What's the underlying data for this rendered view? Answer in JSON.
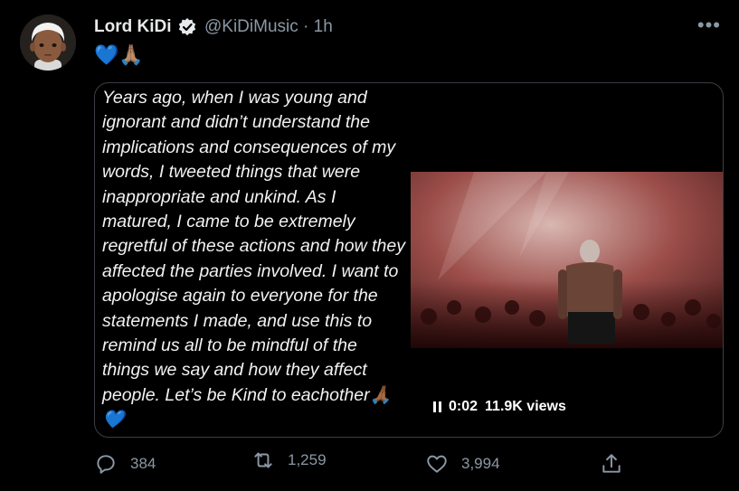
{
  "tweet": {
    "display_name": "Lord KiDi",
    "handle": "@KiDiMusic",
    "separator": "·",
    "time": "1h",
    "text_emojis": "💙🙏🏽"
  },
  "media": {
    "statement_text": "Years ago, when I was young and ignorant and didn’t understand the implications and consequences of my words, I tweeted things that were inappropriate and unkind. As I matured, I came to be extremely regretful of these actions and how they affected the parties involved. I want to apologise again to everyone for the statements I made, and use this to remind us all to be mindful of the things we say and how they affect people. Let’s be Kind to eachother🙏🏾💙",
    "video": {
      "time": "0:02",
      "views": "11.9K views"
    }
  },
  "actions": {
    "replies": "384",
    "retweets": "1,259",
    "likes": "3,994"
  },
  "icons": {
    "verified": "verified-badge-icon",
    "more": "more-horizontal-icon",
    "reply": "reply-icon",
    "retweet": "retweet-icon",
    "like": "heart-icon",
    "share": "share-icon",
    "pause": "pause-icon"
  },
  "colors": {
    "background": "#000000",
    "text": "#e7e9ea",
    "muted": "#8b98a5",
    "border": "#3a3f44",
    "accent": "#1d9bf0"
  }
}
